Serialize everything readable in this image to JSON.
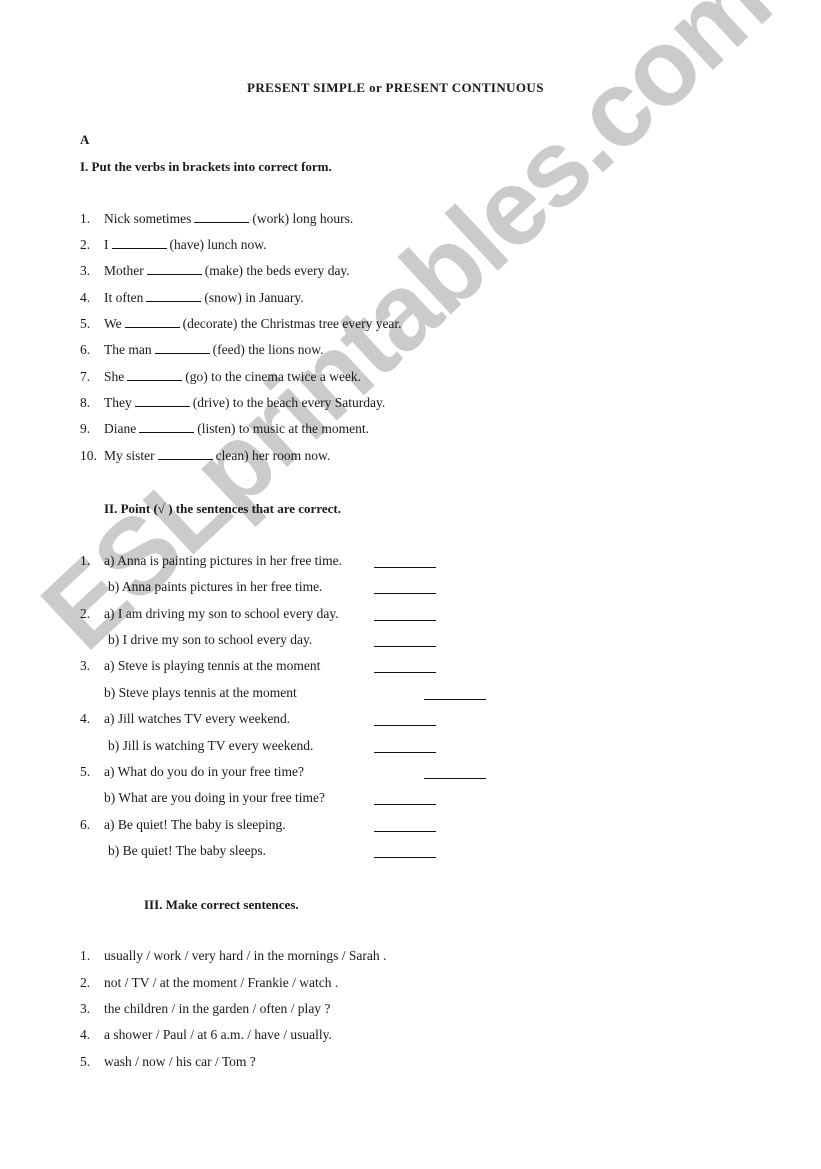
{
  "document": {
    "title": "PRESENT SIMPLE or PRESENT CONTINUOUS",
    "part_label": "A",
    "watermark": "ESLprintables.com"
  },
  "section1": {
    "heading": "I.  Put the verbs in brackets into correct form.",
    "items": [
      {
        "num": "1.",
        "before": "Nick sometimes",
        "after": "(work) long hours."
      },
      {
        "num": "2.",
        "before": "I",
        "after": "(have) lunch now."
      },
      {
        "num": "3.",
        "before": "Mother",
        "after": "(make) the beds every day."
      },
      {
        "num": "4.",
        "before": "It often",
        "after": "(snow) in January."
      },
      {
        "num": "5.",
        "before": "We",
        "after": "(decorate) the Christmas tree every year."
      },
      {
        "num": "6.",
        "before": "The man",
        "after": "(feed) the lions now."
      },
      {
        "num": "7.",
        "before": "She",
        "after": "(go) to the cinema twice a week."
      },
      {
        "num": "8.",
        "before": "They",
        "after": "(drive) to the beach every Saturday."
      },
      {
        "num": "9.",
        "before": "Diane",
        "after": "(listen) to music at the moment."
      },
      {
        "num": "10.",
        "before": "My sister",
        "after": "clean) her room now."
      }
    ]
  },
  "section2": {
    "heading": "II. Point (√ ) the sentences that are correct.",
    "items": [
      {
        "num": "1.",
        "a": "a) Anna is painting pictures in her free time.",
        "b": "b) Anna paints pictures in her free time."
      },
      {
        "num": "2.",
        "a": "a) I am driving my son to school every day.",
        "b": "b) I drive my son to school every day."
      },
      {
        "num": "3.",
        "a": "a) Steve is playing tennis at the moment",
        "b": "b) Steve plays tennis at the moment"
      },
      {
        "num": "4.",
        "a": "a) Jill watches TV every weekend.",
        "b": "b) Jill is watching TV every weekend."
      },
      {
        "num": "5.",
        "a": "a) What do you do in your free time?",
        "b": "b) What are you doing in your free time?"
      },
      {
        "num": "6.",
        "a": "a) Be quiet! The baby is sleeping.",
        "b": "b) Be quiet! The baby sleeps."
      }
    ]
  },
  "section3": {
    "heading": "III. Make correct sentences.",
    "items": [
      {
        "num": "1.",
        "text": "usually / work / very hard / in  the mornings / Sarah ."
      },
      {
        "num": "2.",
        "text": "not / TV / at the moment / Frankie / watch ."
      },
      {
        "num": "3.",
        "text": "the children / in the garden / often / play ?"
      },
      {
        "num": "4.",
        "text": "a shower / Paul / at  6 a.m. / have / usually."
      },
      {
        "num": "5.",
        "text": "wash / now / his car / Tom ?"
      }
    ]
  }
}
